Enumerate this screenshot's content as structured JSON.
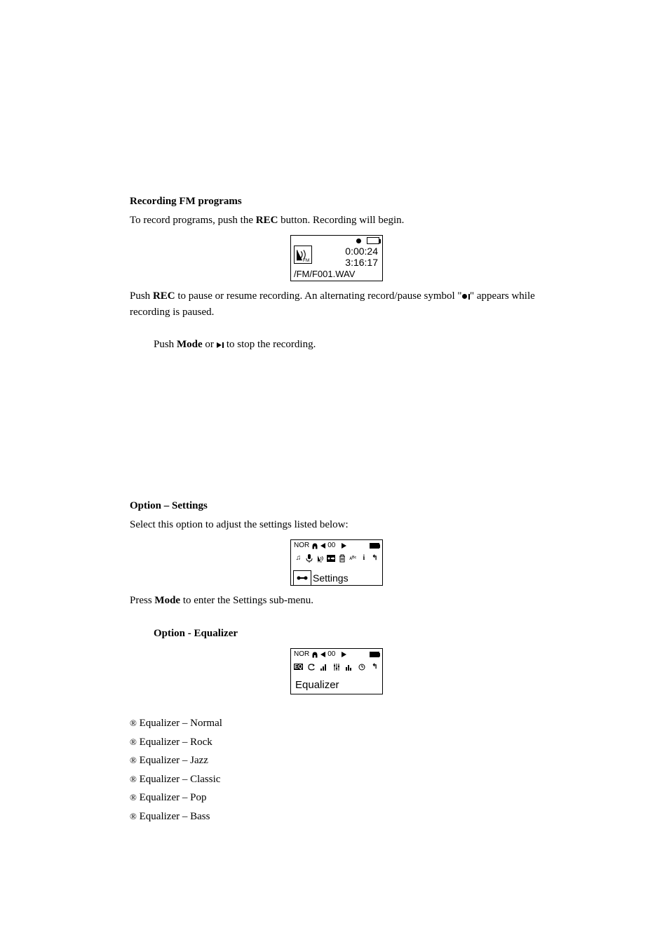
{
  "sec_fm_record": {
    "heading": "Recording FM programs",
    "p1_prefix": "To record programs, push the ",
    "p1_bold1": "REC",
    "p1_suffix": " button. Recording will begin.",
    "fig1": {
      "elapsed": "0:00:24",
      "remaining": "3:16:17",
      "file": "/FM/F001.WAV"
    },
    "p2_prefix": "Push ",
    "p2_bold1": "REC",
    "p2_mid": " to pause or resume recording. An alternating record/pause symbol \"",
    "p2_suffix": "\" appears while recording is paused.",
    "p3_prefix": "Push ",
    "p3_bold1": "Mode",
    "p3_mid": " or ",
    "p3_suffix": " to stop the recording."
  },
  "sec_settings": {
    "heading": "Option – Settings",
    "p1": "Select this option to adjust the settings listed below:",
    "fig": {
      "status_text_left": "NOR",
      "volume": "00",
      "sel_label": "Settings"
    },
    "p2_prefix": "Press ",
    "p2_bold1": "Mode",
    "p2_suffix": " to enter the Settings sub-menu.",
    "sub": {
      "heading": "Option - Equalizer",
      "fig": {
        "status_text_left": "NOR",
        "volume": "00",
        "label": "Equalizer"
      },
      "items": [
        "Equalizer – Normal",
        "Equalizer – Rock",
        "Equalizer – Jazz",
        "Equalizer – Classic",
        "Equalizer – Pop",
        "Equalizer – Bass"
      ]
    }
  }
}
